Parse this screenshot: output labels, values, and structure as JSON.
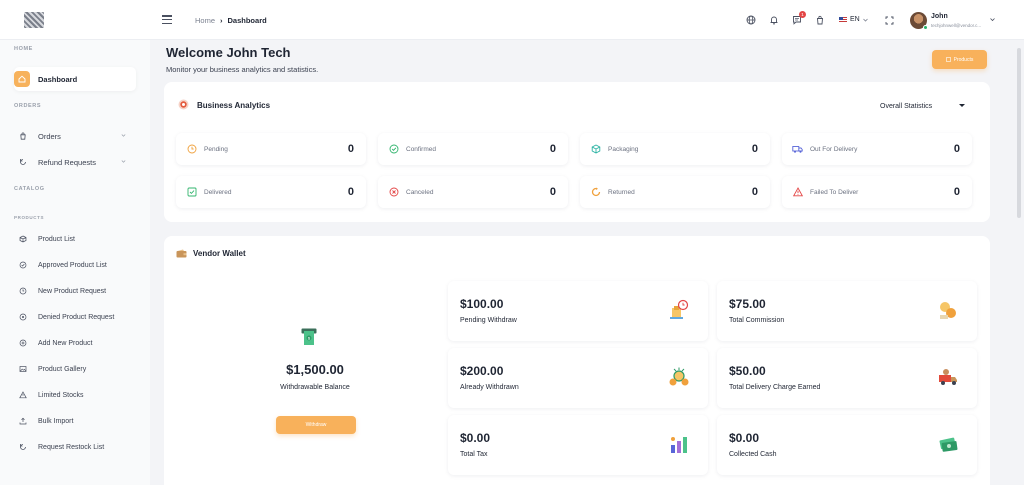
{
  "header": {
    "breadcrumb": {
      "home": "Home",
      "separator": "›",
      "current": "Dashboard"
    },
    "notification_count": "1",
    "language": "EN",
    "user": {
      "name": "John",
      "email": "techjohnwell@vendor.c..."
    }
  },
  "sidebar": {
    "sections": {
      "home": "HOME",
      "orders": "ORDERS",
      "catalog": "CATALOG",
      "products": "PRODUCTS"
    },
    "items": [
      {
        "label": "Dashboard",
        "icon": "home-icon",
        "active": true
      },
      {
        "label": "Orders",
        "icon": "cart-icon",
        "has_submenu": true
      },
      {
        "label": "Refund Requests",
        "icon": "refresh-icon",
        "has_submenu": true
      },
      {
        "label": "Product List",
        "icon": "box-icon"
      },
      {
        "label": "Approved Product List",
        "icon": "check-circle-icon"
      },
      {
        "label": "New Product Request",
        "icon": "clock-icon"
      },
      {
        "label": "Denied Product Request",
        "icon": "ban-icon"
      },
      {
        "label": "Add New Product",
        "icon": "plus-circle-icon"
      },
      {
        "label": "Product Gallery",
        "icon": "image-icon"
      },
      {
        "label": "Limited Stocks",
        "icon": "warning-icon"
      },
      {
        "label": "Bulk Import",
        "icon": "upload-icon"
      },
      {
        "label": "Request Restock List",
        "icon": "history-icon"
      }
    ]
  },
  "main": {
    "welcome": "Welcome John Tech",
    "subtitle": "Monitor your business analytics and statistics.",
    "products_button": "Products",
    "business_analytics": {
      "title": "Business Analytics",
      "filter": "Overall Statistics",
      "stats": [
        {
          "label": "Pending",
          "value": "0",
          "icon": "clock-icon",
          "color": "#f0a13c"
        },
        {
          "label": "Confirmed",
          "value": "0",
          "icon": "check-circle-icon",
          "color": "#31b46d"
        },
        {
          "label": "Packaging",
          "value": "0",
          "icon": "package-icon",
          "color": "#2bb3a3"
        },
        {
          "label": "Out For Delivery",
          "value": "0",
          "icon": "truck-icon",
          "color": "#5865d8"
        },
        {
          "label": "Delivered",
          "value": "0",
          "icon": "checkbox-icon",
          "color": "#31b46d"
        },
        {
          "label": "Canceled",
          "value": "0",
          "icon": "x-circle-icon",
          "color": "#e34545"
        },
        {
          "label": "Returned",
          "value": "0",
          "icon": "return-icon",
          "color": "#f0a13c"
        },
        {
          "label": "Failed To Deliver",
          "value": "0",
          "icon": "alert-triangle-icon",
          "color": "#e34545"
        }
      ]
    },
    "vendor_wallet": {
      "title": "Vendor Wallet",
      "balance": {
        "value": "$1,500.00",
        "label": "Withdrawable Balance",
        "button": "Withdraw"
      },
      "tiles": [
        {
          "value": "$100.00",
          "label": "Pending Withdraw",
          "icon": "pending-withdraw-icon"
        },
        {
          "value": "$75.00",
          "label": "Total Commission",
          "icon": "commission-icon"
        },
        {
          "value": "$200.00",
          "label": "Already Withdrawn",
          "icon": "coins-icon"
        },
        {
          "value": "$50.00",
          "label": "Total Delivery Charge Earned",
          "icon": "delivery-charge-icon"
        },
        {
          "value": "$0.00",
          "label": "Total Tax",
          "icon": "tax-icon"
        },
        {
          "value": "$0.00",
          "label": "Collected Cash",
          "icon": "cash-icon"
        }
      ]
    }
  },
  "colors": {
    "accent": "#f8b15b",
    "danger": "#e34545",
    "success": "#31b46d"
  }
}
